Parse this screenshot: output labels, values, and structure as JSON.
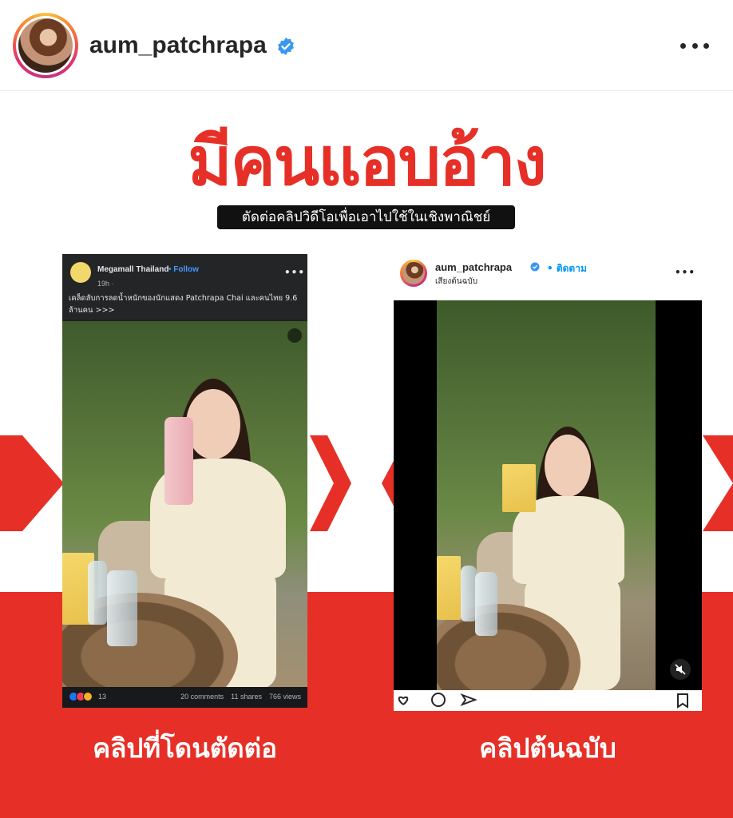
{
  "header": {
    "username": "aum_patchrapa",
    "verified": true,
    "more_icon": "more-horizontal-icon"
  },
  "post": {
    "headline": "มีคนแอบอ้าง",
    "subheadline": "ตัดต่อคลิปวิดีโอเพื่อเอาไปใช้ในเชิงพาณิชย์",
    "colors": {
      "accent": "#e63027",
      "text_dark": "#262626",
      "link_blue": "#0095f6"
    },
    "left_card": {
      "page_name": "Megamall Thailand",
      "follow_label": "• Follow",
      "time": "19h ·",
      "caption": "เคล็ดลับการลดน้ำหนักของนักแสดง Patchrapa Chai และคนไทย 9.6 ล้านคน >>>",
      "reaction_count": "13",
      "comments": "20 comments",
      "shares": "11 shares",
      "views": "766 views",
      "label": "คลิปที่โดนตัดต่อ"
    },
    "right_card": {
      "username": "aum_patchrapa",
      "follow_label": "• ติดตาม",
      "audio": "เสียงต้นฉบับ",
      "label": "คลิปต้นฉบับ"
    }
  }
}
